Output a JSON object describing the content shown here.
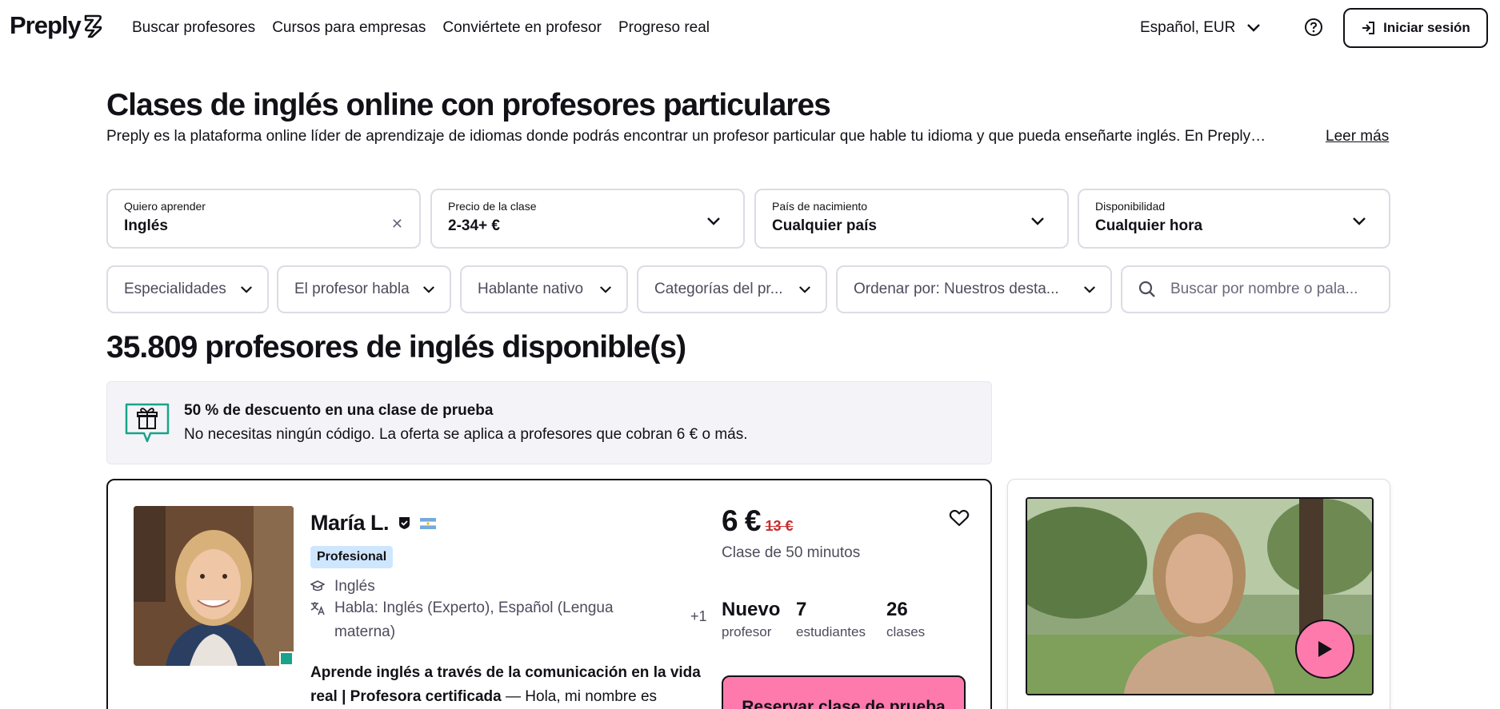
{
  "brand": {
    "name": "Preply"
  },
  "nav": {
    "links": [
      "Buscar profesores",
      "Cursos para empresas",
      "Conviértete en profesor",
      "Progreso real"
    ]
  },
  "header": {
    "language": "Español, EUR",
    "login_label": "Iniciar sesión"
  },
  "page": {
    "title": "Clases de inglés online con profesores particulares",
    "description": "Preply es la plataforma online líder de aprendizaje de idiomas donde podrás encontrar un profesor particular que hable tu idioma y que pueda enseñarte inglés. En Preply…",
    "read_more": "Leer más"
  },
  "filters": {
    "learn": {
      "label": "Quiero aprender",
      "value": "Inglés"
    },
    "price": {
      "label": "Precio de la clase",
      "value": "2-34+ €"
    },
    "country": {
      "label": "País de nacimiento",
      "value": "Cualquier país"
    },
    "availability": {
      "label": "Disponibilidad",
      "value": "Cualquier hora"
    }
  },
  "pills": {
    "specialties": "Especialidades",
    "speaks": "El profesor habla",
    "native": "Hablante nativo",
    "categories": "Categorías del pr...",
    "sort": "Ordenar por: Nuestros desta...",
    "search_placeholder": "Buscar por nombre o pala..."
  },
  "results": {
    "count_title": "35.809 profesores de inglés disponible(s)"
  },
  "promo": {
    "title": "50 % de descuento en una clase de prueba",
    "text": "No necesitas ningún código. La oferta se aplica a profesores que cobran 6 € o más."
  },
  "tutor": {
    "name": "María L.",
    "badge": "Profesional",
    "subject": "Inglés",
    "speaks": "Habla: Inglés (Experto), Español (Lengua materna)",
    "speaks_more": "+1",
    "headline_bold": "Aprende inglés a través de la comunicación en la vida real | Profesora certificada",
    "headline_rest": " — Hola, mi nombre es",
    "price": "6 €",
    "price_old": "13 €",
    "duration": "Clase de 50 minutos",
    "stats": [
      {
        "value": "Nuevo",
        "label": "profesor"
      },
      {
        "value": "7",
        "label": "estudiantes"
      },
      {
        "value": "26",
        "label": "clases"
      }
    ],
    "book_label": "Reservar clase de prueba"
  },
  "colors": {
    "accent_pink": "#ff7aac",
    "badge_blue": "#cfe6ff",
    "old_price_red": "#c82d2d",
    "online_green": "#19a38a"
  }
}
